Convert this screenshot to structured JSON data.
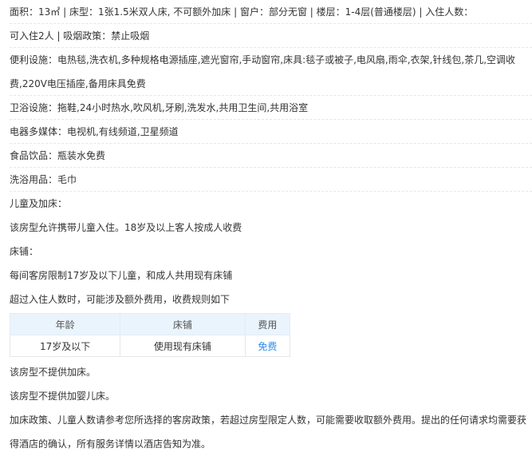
{
  "lines": [
    "面积：13㎡ | 床型：1张1.5米双人床, 不可额外加床 | 窗户：部分无窗 | 楼层：1-4层(普通楼层) | 入住人数：",
    "可入住2人 | 吸烟政策：禁止吸烟",
    "便利设施：电热毯,洗衣机,多种规格电源插座,遮光窗帘,手动窗帘,床具:毯子或被子,电风扇,雨伞,衣架,针线包,茶几,空调收",
    "费,220V电压插座,备用床具免费",
    "卫浴设施：拖鞋,24小时热水,吹风机,牙刷,洗发水,共用卫生间,共用浴室",
    "电器多媒体：电视机,有线频道,卫星频道",
    "食品饮品：瓶装水免费",
    "洗浴用品：毛巾",
    "儿童及加床：",
    "该房型允许携带儿童入住。18岁及以上客人按成人收费",
    "床铺：",
    "每间客房限制17岁及以下儿童，和成人共用现有床铺",
    "超过入住人数时，可能涉及额外费用，收费规则如下"
  ],
  "table": {
    "headers": [
      "年龄",
      "床铺",
      "费用"
    ],
    "row": [
      "17岁及以下",
      "使用现有床铺",
      "免费"
    ]
  },
  "after": [
    "该房型不提供加床。",
    "该房型不提供加婴儿床。",
    "加床政策、儿童人数请参考您所选择的客房政策，若超过房型限定人数，可能需要收取额外费用。提出的任何请求均需要获",
    "得酒店的确认，所有服务详情以酒店告知为准。"
  ]
}
